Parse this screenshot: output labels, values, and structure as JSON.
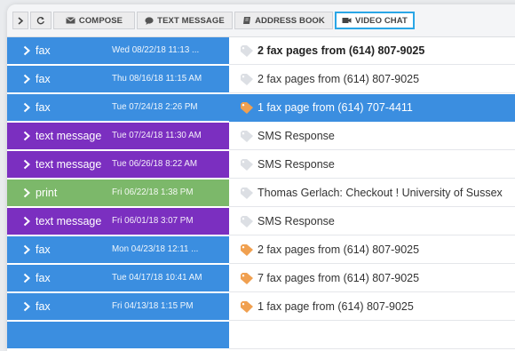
{
  "toolbar": {
    "expand_label": "",
    "refresh_label": "",
    "compose_label": "COMPOSE",
    "text_message_label": "TEXT MESSAGE",
    "address_book_label": "ADDRESS BOOK",
    "video_chat_label": "VIDEO CHAT"
  },
  "colors": {
    "fax": "#3b8ee0",
    "text_message": "#7b2fc0",
    "print": "#7cb86a",
    "tag_orange": "#f0a050",
    "tag_gray": "#dcdfe4",
    "active_outline": "#2aa6e6"
  },
  "messages": [
    {
      "type": "fax",
      "date": "Wed 08/22/18 11:13 ...",
      "subject": "2 fax pages from (614) 807-9025",
      "tag": "gray",
      "bold": true,
      "selected": false
    },
    {
      "type": "fax",
      "date": "Thu 08/16/18 11:15 AM",
      "subject": "2 fax pages from (614) 807-9025",
      "tag": "gray",
      "bold": false,
      "selected": false
    },
    {
      "type": "fax",
      "date": "Tue 07/24/18 2:26 PM",
      "subject": "1 fax page from (614) 707-4411",
      "tag": "orange",
      "bold": false,
      "selected": true
    },
    {
      "type": "text message",
      "date": "Tue 07/24/18 11:30 AM",
      "subject": "SMS Response",
      "tag": "gray",
      "bold": false,
      "selected": false
    },
    {
      "type": "text message",
      "date": "Tue 06/26/18 8:22 AM",
      "subject": "SMS Response",
      "tag": "gray",
      "bold": false,
      "selected": false
    },
    {
      "type": "print",
      "date": "Fri 06/22/18 1:38 PM",
      "subject": "Thomas Gerlach: Checkout ! University of Sussex",
      "tag": "gray",
      "bold": false,
      "selected": false
    },
    {
      "type": "text message",
      "date": "Fri 06/01/18 3:07 PM",
      "subject": "SMS Response",
      "tag": "gray",
      "bold": false,
      "selected": false
    },
    {
      "type": "fax",
      "date": "Mon 04/23/18 12:11 ...",
      "subject": "2 fax pages from (614) 807-9025",
      "tag": "orange",
      "bold": false,
      "selected": false
    },
    {
      "type": "fax",
      "date": "Tue 04/17/18 10:41 AM",
      "subject": "7 fax pages from (614) 807-9025",
      "tag": "orange",
      "bold": false,
      "selected": false
    },
    {
      "type": "fax",
      "date": "Fri 04/13/18 1:15 PM",
      "subject": "1 fax page from (614) 807-9025",
      "tag": "orange",
      "bold": false,
      "selected": false
    }
  ]
}
